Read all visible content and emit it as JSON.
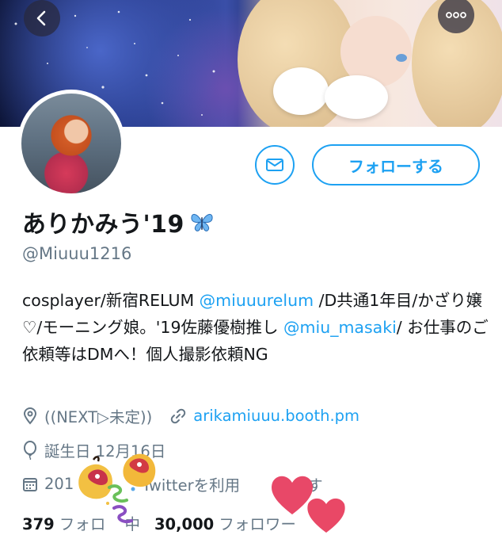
{
  "header": {
    "back_icon": "chevron-left-icon",
    "more_icon": "more-horizontal-icon"
  },
  "actions": {
    "message_icon": "mail-icon",
    "follow_label": "フォローする"
  },
  "profile": {
    "display_name": "ありかみう'19",
    "name_emoji": "butterfly-emoji",
    "handle": "@Miuuu1216",
    "bio": {
      "part1": "cosplayer/新宿RELUM ",
      "mention1": "@miuuurelum",
      "part2": " /D共通1年目/かざり嬢♡/モーニング娘。'19佐藤優樹推し ",
      "mention2": "@miu_masaki",
      "part3": "/ お仕事のご依頼等はDMへ！個人撮影依頼NG"
    },
    "location": "((NEXT▷未定))",
    "website": "arikamiuuu.booth.pm",
    "birthday": "誕生日 12月16日",
    "joined": "201",
    "joined_tail": "Twitterを利用",
    "joined_end": "います"
  },
  "stats": {
    "following_count": "379",
    "following_label": "フォロ",
    "following_label_tail": "中",
    "followers_count": "30,000",
    "followers_label": "フォロワー"
  },
  "colors": {
    "accent": "#1da1f2",
    "secondary_text": "#657786"
  }
}
